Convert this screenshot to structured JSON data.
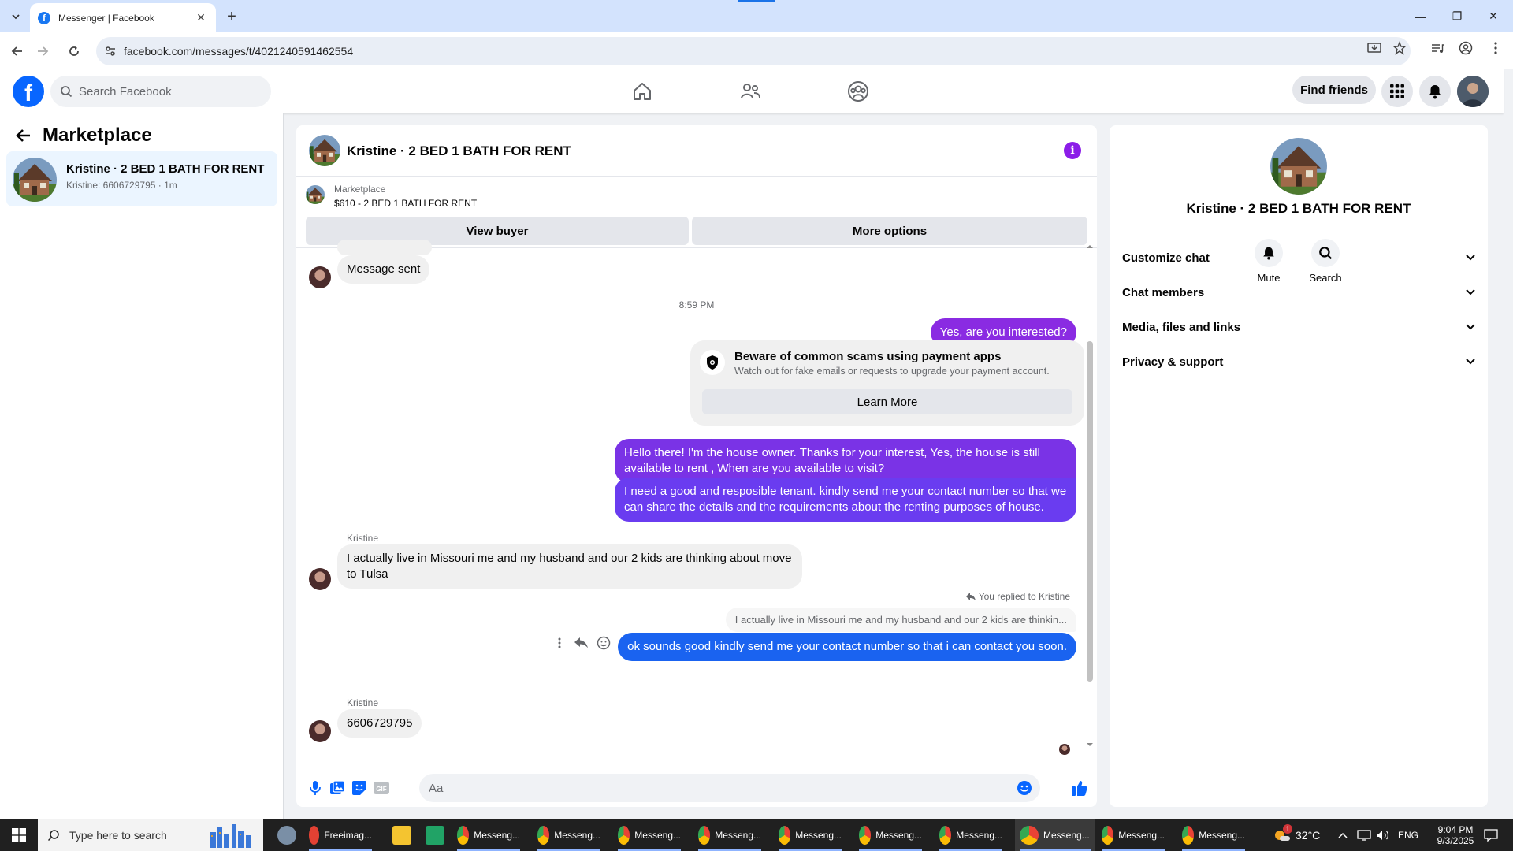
{
  "browser": {
    "tab_title": "Messenger | Facebook",
    "url": "facebook.com/messages/t/4021240591462554"
  },
  "fb": {
    "search_placeholder": "Search Facebook",
    "find_friends": "Find friends"
  },
  "left": {
    "title": "Marketplace",
    "conversation": {
      "name": "Kristine · 2 BED 1 BATH FOR RENT",
      "preview": "Kristine: 6606729795 · 1m"
    }
  },
  "chat": {
    "title": "Kristine · 2 BED 1 BATH FOR RENT",
    "listing_label": "Marketplace",
    "listing_title": "$610 - 2 BED 1 BATH FOR RENT",
    "view_buyer": "View buyer",
    "more_options": "More options",
    "messages": {
      "m1": "Message sent",
      "time": "8:59 PM",
      "m2": "Yes, are you interested?",
      "scam_title": "Beware of common scams using payment apps",
      "scam_sub": "Watch out for fake emails or requests to upgrade your payment account.",
      "learn_more": "Learn More",
      "m3": "Hello there! I'm the house owner. Thanks for your interest, Yes, the house is still available to rent , When are you available to visit?",
      "m4": "I need a good and resposible tenant.  kindly send me your contact number so that we can share the details and the requirements about the renting purposes of house.",
      "sender1": "Kristine",
      "m5": "I actually live in Missouri me and my husband and our 2 kids are thinking about move to Tulsa",
      "reply_note": "You replied to Kristine",
      "reply_quote": "I actually live in Missouri me and my husband and our 2 kids are thinkin...",
      "m6": "ok sounds good kindly  send me your contact number so that i can contact you soon.",
      "sender2": "Kristine",
      "m7": "6606729795"
    },
    "composer_placeholder": "Aa",
    "colors": {
      "purple": "#8a2be2",
      "violet": "#6a3cf0",
      "blue": "#1a63f0"
    }
  },
  "right": {
    "name": "Kristine · 2 BED 1 BATH FOR RENT",
    "mute": "Mute",
    "search": "Search",
    "rows": [
      "Customize chat",
      "Chat members",
      "Media, files and links",
      "Privacy & support"
    ]
  },
  "taskbar": {
    "search_placeholder": "Type here to search",
    "apps": [
      "Freeimag...",
      "Messeng...",
      "Messeng...",
      "Messeng...",
      "Messeng...",
      "Messeng...",
      "Messeng...",
      "Messeng...",
      "Messeng...",
      "Messeng...",
      "Messeng..."
    ],
    "weather": "32°C",
    "lang": "ENG",
    "time": "9:04 PM",
    "date": "9/3/2025",
    "badge": "1"
  }
}
